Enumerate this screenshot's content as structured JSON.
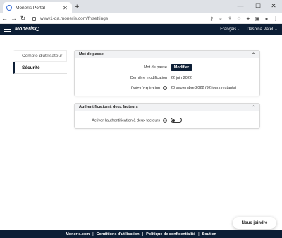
{
  "browser": {
    "tab_title": "Moneris Portal",
    "tab_close": "✕",
    "new_tab": "+",
    "url": "www1-qa.moneris.com/fr/settings",
    "controls": {
      "minimize": "—",
      "maximize": "☐",
      "close": "✕"
    }
  },
  "header": {
    "logo": "Moneris",
    "language": "Français",
    "user": "Despina Patel"
  },
  "sidebar": {
    "items": [
      {
        "label": "Compte d'utilisateur",
        "active": false
      },
      {
        "label": "Sécurité",
        "active": true
      }
    ]
  },
  "password_card": {
    "title": "Mot de passe",
    "rows": {
      "password_label": "Mot de passe",
      "modify_button": "Modifier",
      "last_modified_label": "Dernière modification",
      "last_modified_value": "22 juin 2022",
      "expiry_label": "Date d'expiration",
      "expiry_value": "20 septembre 2022 (92 jours restants)"
    }
  },
  "mfa_card": {
    "title": "Authentification à deux facteurs",
    "toggle_label": "Activer l'authentification à deux facteurs",
    "enabled": false
  },
  "chat_button": "Nous joindre",
  "footer": {
    "links": [
      "Moneris.com",
      "Conditions d'utilisation",
      "Politique de confidentialité",
      "Soutien"
    ],
    "separator": "|"
  },
  "colors": {
    "brand_navy": "#0c1e35"
  }
}
